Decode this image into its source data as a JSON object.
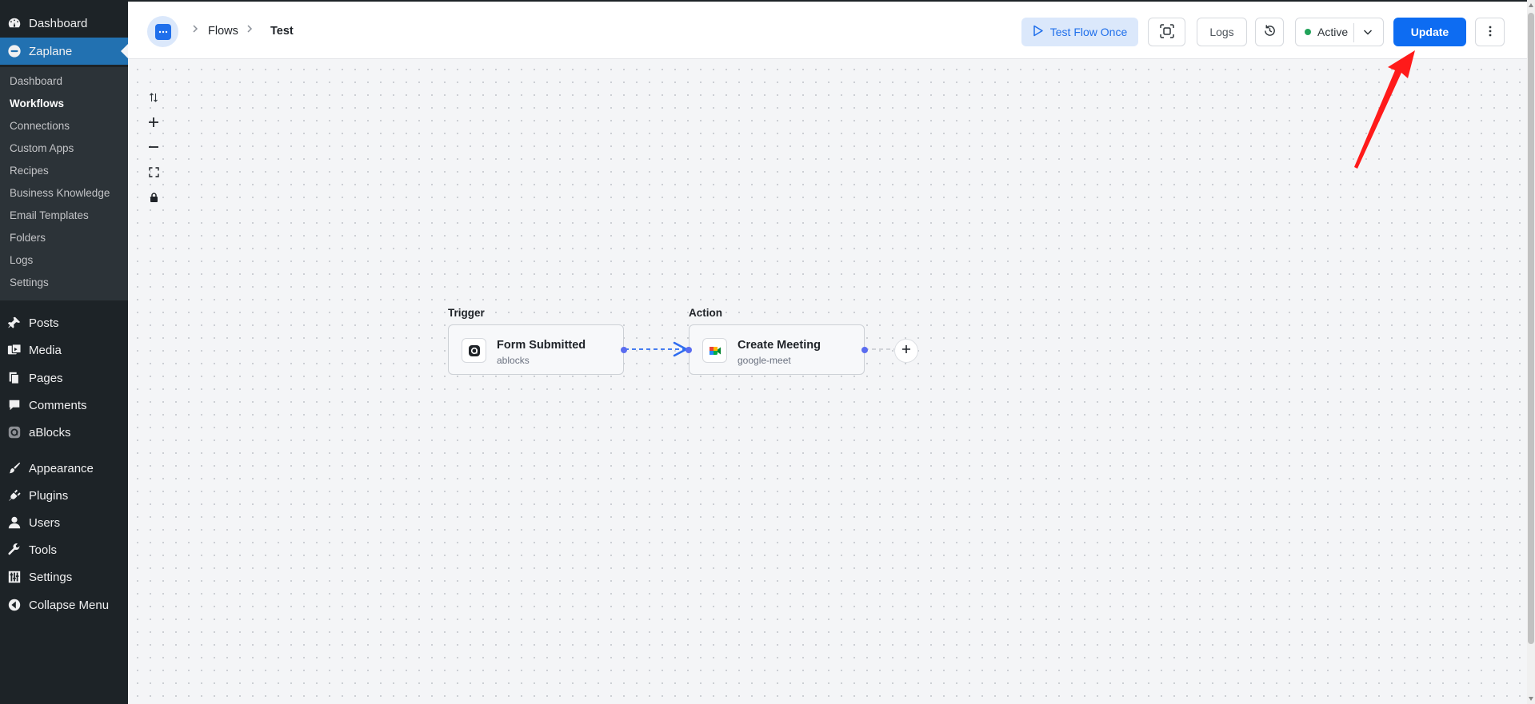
{
  "sidebar": {
    "dashboard": "Dashboard",
    "zaplane": "Zaplane",
    "submenu": [
      "Dashboard",
      "Workflows",
      "Connections",
      "Custom Apps",
      "Recipes",
      "Business Knowledge",
      "Email Templates",
      "Folders",
      "Logs",
      "Settings"
    ],
    "posts": "Posts",
    "media": "Media",
    "pages": "Pages",
    "comments": "Comments",
    "ablocks": "aBlocks",
    "appearance": "Appearance",
    "plugins": "Plugins",
    "users": "Users",
    "tools": "Tools",
    "settings": "Settings",
    "collapse": "Collapse Menu"
  },
  "header": {
    "breadcrumb": [
      "Flows",
      "Test"
    ],
    "test_flow_label": "Test Flow Once",
    "logs_label": "Logs",
    "status_label": "Active",
    "update_label": "Update"
  },
  "flow": {
    "trigger": {
      "section_label": "Trigger",
      "title": "Form Submitted",
      "app": "ablocks"
    },
    "action": {
      "section_label": "Action",
      "title": "Create Meeting",
      "app": "google-meet"
    }
  },
  "colors": {
    "sidebar_bg": "#1d2327",
    "submenu_bg": "#2c3338",
    "wp_blue": "#2271b1",
    "primary": "#0d6cf2",
    "active_dot": "#22a35a",
    "annotation_arrow": "#ff1a1a"
  },
  "icons": {
    "dashboard": "gauge-icon",
    "zaplane": "zaplane-logo-icon",
    "posts": "pushpin-icon",
    "media": "media-icon",
    "pages": "pages-icon",
    "comments": "comment-bubble-icon",
    "ablocks": "ablocks-logo-icon",
    "appearance": "paintbrush-icon",
    "plugins": "plug-icon",
    "users": "user-icon",
    "tools": "wrench-icon",
    "settings": "sliders-icon",
    "collapse": "collapse-arrow-icon"
  }
}
